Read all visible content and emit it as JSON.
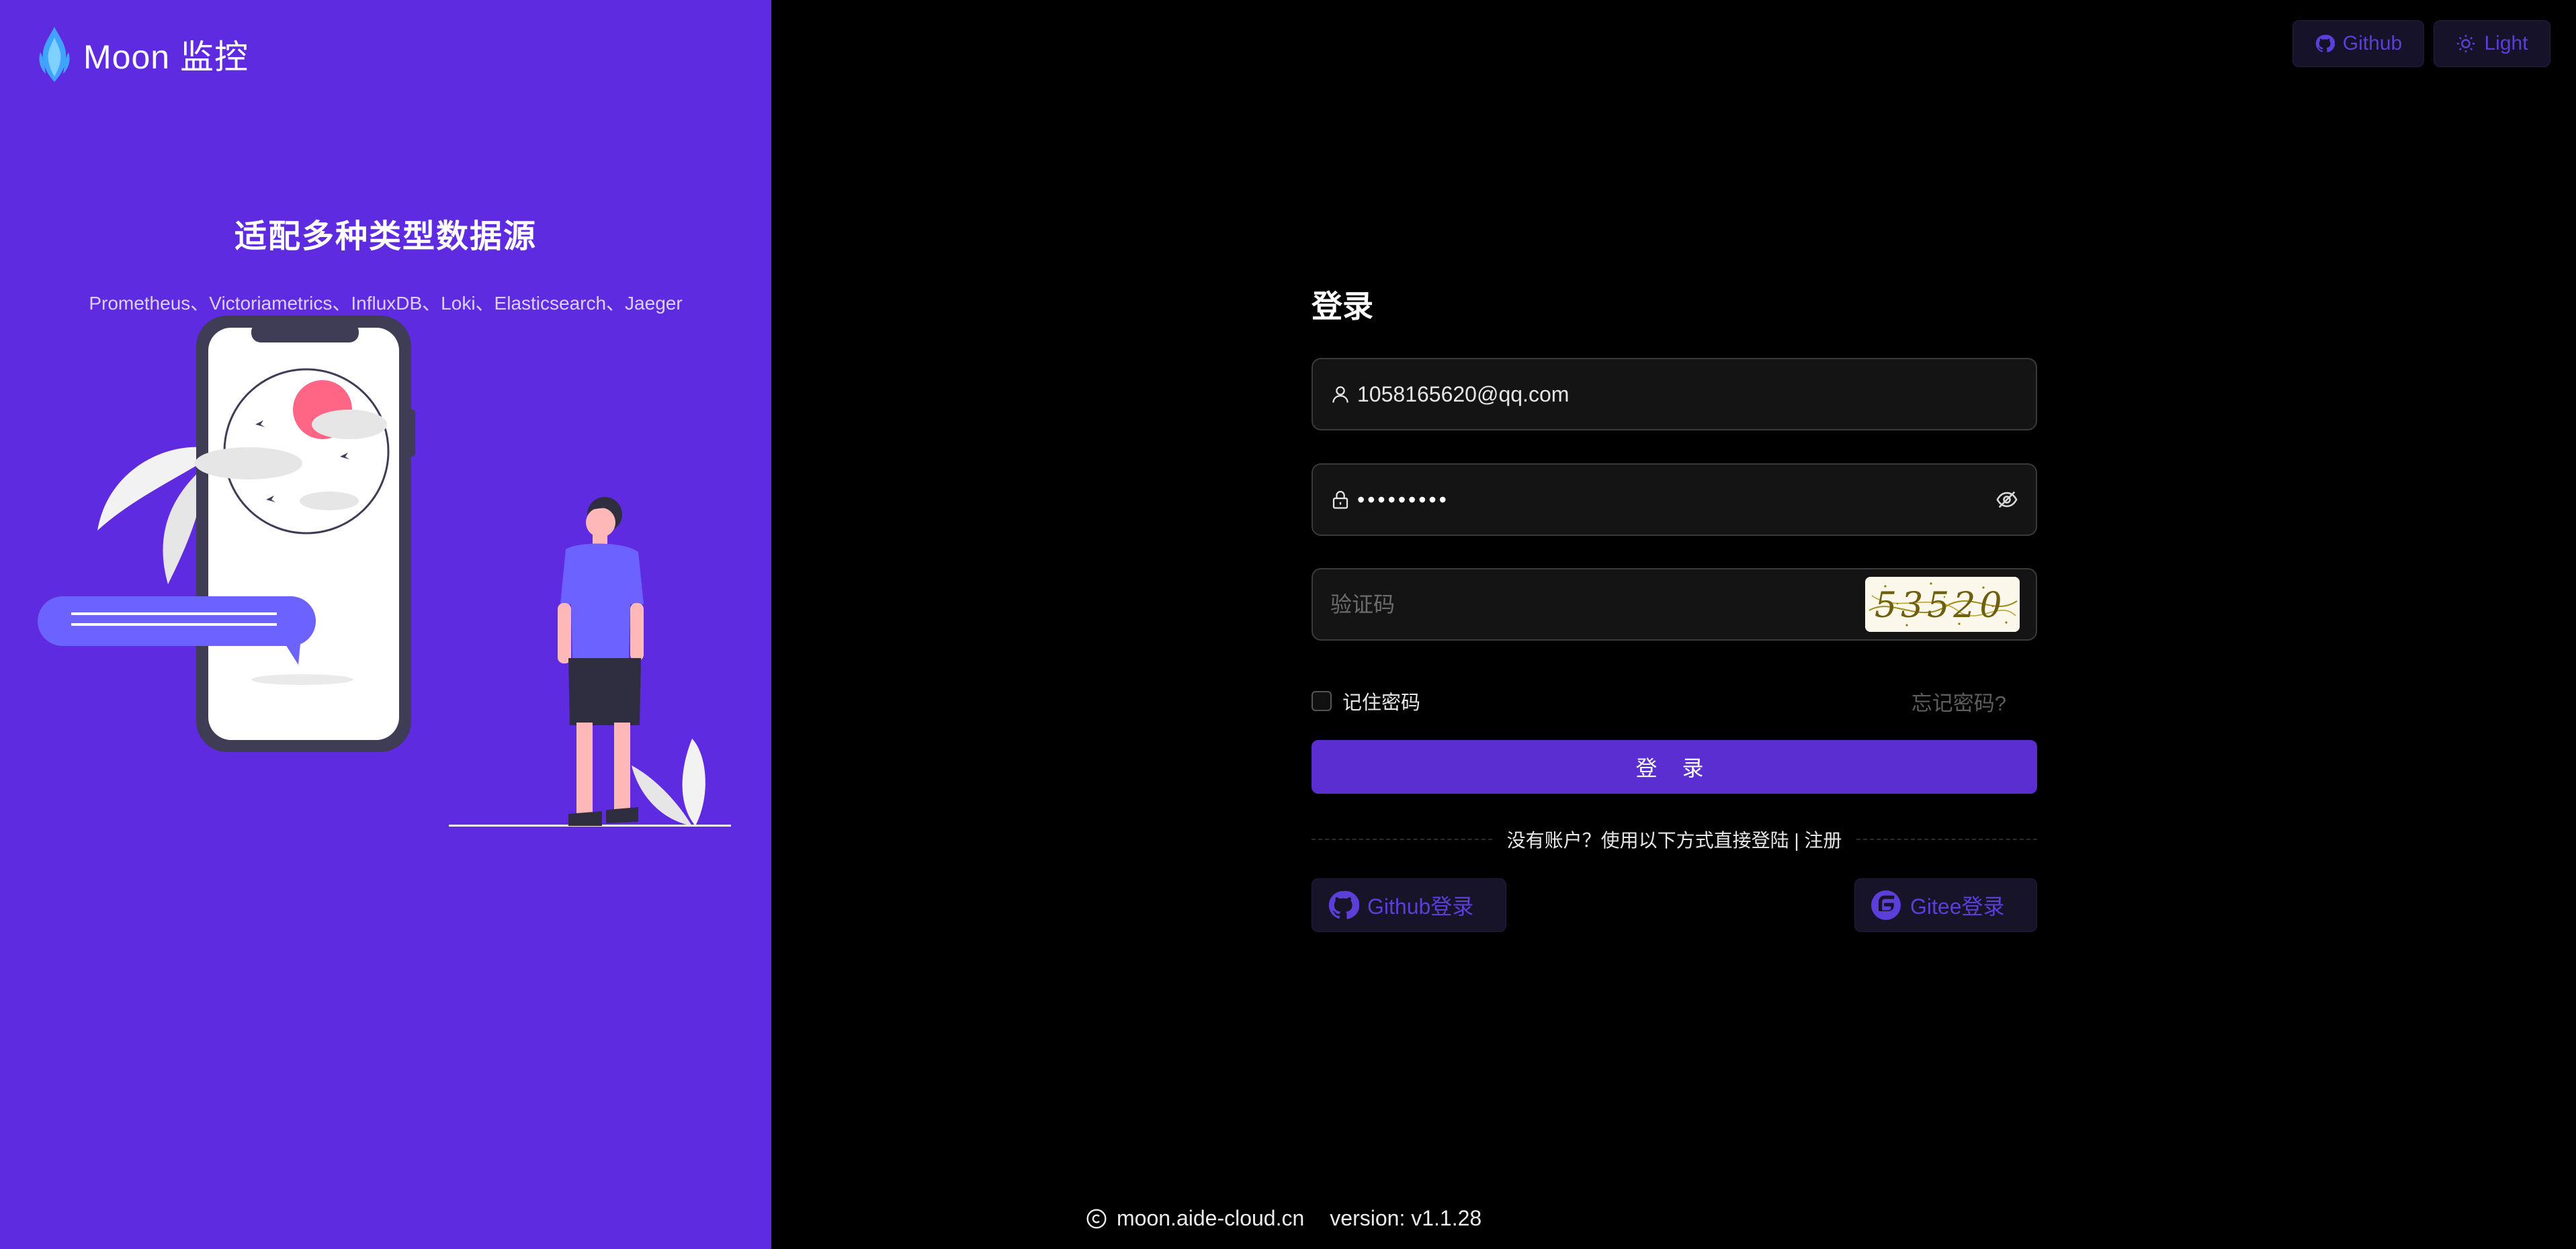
{
  "brand": {
    "name": "Moon 监控"
  },
  "hero": {
    "title": "适配多种类型数据源",
    "subtitle": "Prometheus、Victoriametrics、InfluxDB、Loki、Elasticsearch、Jaeger"
  },
  "header": {
    "github_label": "Github",
    "theme_label": "Light"
  },
  "login": {
    "title": "登录",
    "email_value": "1058165620@qq.com",
    "password_mask": "•••••••••",
    "captcha_placeholder": "验证码",
    "captcha_text": "53520",
    "remember_label": "记住密码",
    "forgot_label": "忘记密码?",
    "submit_label": "登 录",
    "divider_text": "没有账户？使用以下方式直接登陆 | 注册",
    "github_login_label": "Github登录",
    "gitee_login_label": "Gitee登录"
  },
  "footer": {
    "site": "moon.aide-cloud.cn",
    "version": "version: v1.1.28"
  },
  "colors": {
    "left_panel": "#5f2be1",
    "accent": "#5a2ed0",
    "background": "#000000"
  }
}
